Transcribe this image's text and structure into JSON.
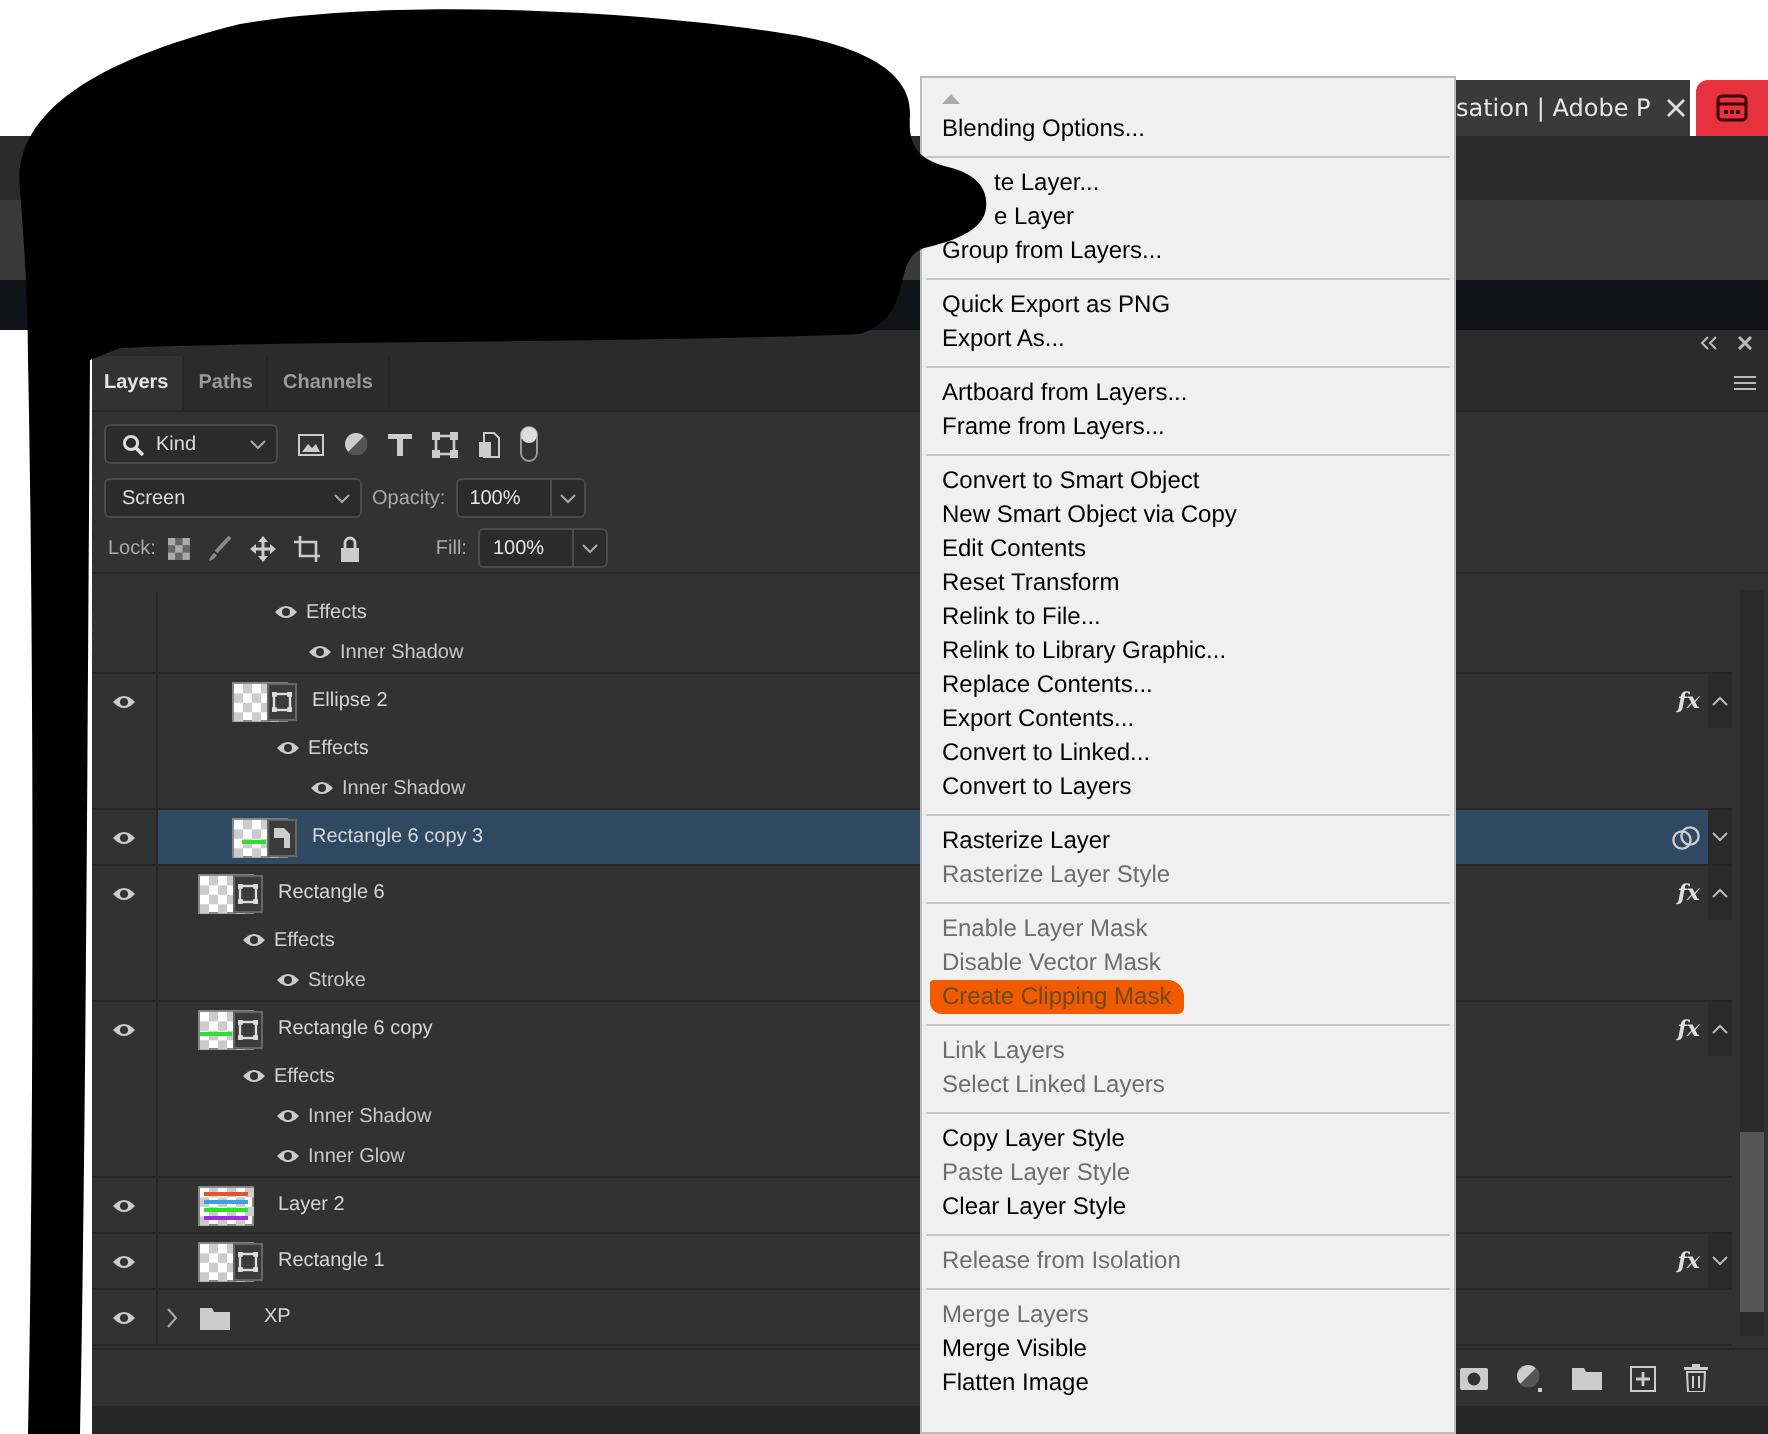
{
  "browser_tab": {
    "title": "sation | Adobe P"
  },
  "panel": {
    "tabs": [
      {
        "label": "Layers",
        "selected": true
      },
      {
        "label": "Paths",
        "selected": false
      },
      {
        "label": "Channels",
        "selected": false
      }
    ],
    "filter": {
      "value": "Kind"
    },
    "blend_mode": "Screen",
    "opacity_label": "Opacity:",
    "opacity": "100%",
    "lock_label": "Lock:",
    "fill_label": "Fill:",
    "fill": "100%"
  },
  "layers": [
    {
      "kind": "effects",
      "label": "Effects",
      "visible": true,
      "children": [
        {
          "kind": "effect",
          "label": "Inner Shadow",
          "visible": true
        }
      ]
    },
    {
      "kind": "layer",
      "thumbnail": {
        "kind": "shape"
      },
      "name": "Ellipse 2",
      "visible": true,
      "selected": false,
      "clipped": true,
      "badge": "fx",
      "expanded": true,
      "children": [
        {
          "kind": "effects",
          "label": "Effects",
          "visible": true,
          "children": [
            {
              "kind": "effect",
              "label": "Inner Shadow",
              "visible": true
            }
          ]
        }
      ]
    },
    {
      "kind": "layer",
      "thumbnail": {
        "kind": "smart"
      },
      "name": "Rectangle 6 copy 3",
      "visible": true,
      "selected": true,
      "clipped": true,
      "expanded": false
    },
    {
      "kind": "layer",
      "thumbnail": {
        "kind": "shape"
      },
      "name": "Rectangle 6",
      "visible": true,
      "selected": false,
      "clipped": false,
      "badge": "fx",
      "expanded": true,
      "children": [
        {
          "kind": "effects",
          "label": "Effects",
          "visible": true,
          "children": [
            {
              "kind": "effect",
              "label": "Stroke",
              "visible": true
            }
          ]
        }
      ]
    },
    {
      "kind": "layer",
      "thumbnail": {
        "kind": "shape-line"
      },
      "name": "Rectangle 6 copy",
      "visible": true,
      "selected": false,
      "clipped": false,
      "badge": "fx",
      "expanded": true,
      "children": [
        {
          "kind": "effects",
          "label": "Effects",
          "visible": true,
          "children": [
            {
              "kind": "effect",
              "label": "Inner Shadow",
              "visible": true
            },
            {
              "kind": "effect",
              "label": "Inner Glow",
              "visible": true
            }
          ]
        }
      ]
    },
    {
      "kind": "layer",
      "thumbnail": {
        "kind": "pixel"
      },
      "name": "Layer 2",
      "visible": true,
      "selected": false,
      "clipped": false
    },
    {
      "kind": "layer",
      "thumbnail": {
        "kind": "shape"
      },
      "name": "Rectangle 1",
      "visible": true,
      "selected": false,
      "clipped": false,
      "badge": "fx",
      "expanded": false
    },
    {
      "kind": "group",
      "name": "XP",
      "visible": true,
      "selected": false,
      "clipped": false,
      "expanded": false
    }
  ],
  "context_menu": {
    "groups": [
      [
        {
          "label": "Blending Options...",
          "disabled": false,
          "covered": false,
          "marked": false
        }
      ],
      [
        {
          "label": "te Layer...",
          "disabled": false,
          "covered": true,
          "marked": false
        },
        {
          "label": "e Layer",
          "disabled": false,
          "covered": true,
          "marked": false
        },
        {
          "label": "Group from Layers...",
          "disabled": false,
          "covered": false,
          "marked": false
        }
      ],
      [
        {
          "label": "Quick Export as PNG",
          "disabled": false,
          "covered": false,
          "marked": false
        },
        {
          "label": "Export As...",
          "disabled": false,
          "covered": false,
          "marked": false
        }
      ],
      [
        {
          "label": "Artboard from Layers...",
          "disabled": false,
          "covered": false,
          "marked": false
        },
        {
          "label": "Frame from Layers...",
          "disabled": false,
          "covered": false,
          "marked": false
        }
      ],
      [
        {
          "label": "Convert to Smart Object",
          "disabled": false,
          "covered": false,
          "marked": false
        },
        {
          "label": "New Smart Object via Copy",
          "disabled": false,
          "covered": false,
          "marked": false
        },
        {
          "label": "Edit Contents",
          "disabled": false,
          "covered": false,
          "marked": false
        },
        {
          "label": "Reset Transform",
          "disabled": false,
          "covered": false,
          "marked": false
        },
        {
          "label": "Relink to File...",
          "disabled": false,
          "covered": false,
          "marked": false
        },
        {
          "label": "Relink to Library Graphic...",
          "disabled": false,
          "covered": false,
          "marked": false
        },
        {
          "label": "Replace Contents...",
          "disabled": false,
          "covered": false,
          "marked": false
        },
        {
          "label": "Export Contents...",
          "disabled": false,
          "covered": false,
          "marked": false
        },
        {
          "label": "Convert to Linked...",
          "disabled": false,
          "covered": false,
          "marked": false
        },
        {
          "label": "Convert to Layers",
          "disabled": false,
          "covered": false,
          "marked": false
        }
      ],
      [
        {
          "label": "Rasterize Layer",
          "disabled": false,
          "covered": false,
          "marked": false
        },
        {
          "label": "Rasterize Layer Style",
          "disabled": true,
          "covered": false,
          "marked": false
        }
      ],
      [
        {
          "label": "Enable Layer Mask",
          "disabled": true,
          "covered": false,
          "marked": false
        },
        {
          "label": "Disable Vector Mask",
          "disabled": true,
          "covered": false,
          "marked": false
        },
        {
          "label": "Create Clipping Mask",
          "disabled": true,
          "covered": false,
          "marked": true
        }
      ],
      [
        {
          "label": "Link Layers",
          "disabled": true,
          "covered": false,
          "marked": false
        },
        {
          "label": "Select Linked Layers",
          "disabled": true,
          "covered": false,
          "marked": false
        }
      ],
      [
        {
          "label": "Copy Layer Style",
          "disabled": false,
          "covered": false,
          "marked": false
        },
        {
          "label": "Paste Layer Style",
          "disabled": true,
          "covered": false,
          "marked": false
        },
        {
          "label": "Clear Layer Style",
          "disabled": false,
          "covered": false,
          "marked": false
        }
      ],
      [
        {
          "label": "Release from Isolation",
          "disabled": true,
          "covered": false,
          "marked": false
        }
      ],
      [
        {
          "label": "Merge Layers",
          "disabled": true,
          "covered": false,
          "marked": false
        },
        {
          "label": "Merge Visible",
          "disabled": false,
          "covered": false,
          "marked": false
        },
        {
          "label": "Flatten Image",
          "disabled": false,
          "covered": false,
          "marked": false
        }
      ]
    ]
  }
}
